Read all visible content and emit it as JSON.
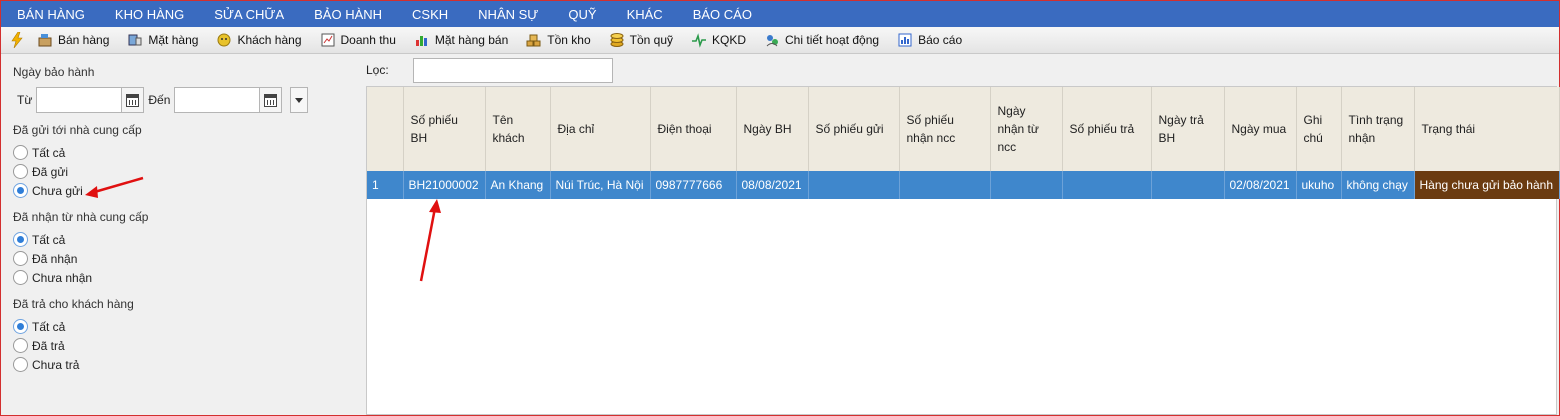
{
  "menu": [
    "BÁN HÀNG",
    "KHO HÀNG",
    "SỬA CHỮA",
    "BẢO HÀNH",
    "CSKH",
    "NHÂN SỰ",
    "QUỸ",
    "KHÁC",
    "BÁO CÁO"
  ],
  "toolbar": [
    {
      "label": "Bán hàng",
      "icon": "cashier-icon"
    },
    {
      "label": "Mặt hàng",
      "icon": "product-icon"
    },
    {
      "label": "Khách hàng",
      "icon": "customer-icon"
    },
    {
      "label": "Doanh thu",
      "icon": "revenue-icon"
    },
    {
      "label": "Mặt hàng bán",
      "icon": "chart-icon"
    },
    {
      "label": "Tồn kho",
      "icon": "stock-icon"
    },
    {
      "label": "Tồn quỹ",
      "icon": "coins-icon"
    },
    {
      "label": "KQKD",
      "icon": "pulse-icon"
    },
    {
      "label": "Chi tiết hoạt động",
      "icon": "activity-icon"
    },
    {
      "label": "Báo cáo",
      "icon": "report-icon"
    }
  ],
  "filters": {
    "date_title": "Ngày bảo hành",
    "from_label": "Từ",
    "to_label": "Đến",
    "from_value": "",
    "to_value": "",
    "sent_title": "Đã gửi tới nhà cung cấp",
    "sent_options": [
      "Tất cả",
      "Đã gửi",
      "Chưa gửi"
    ],
    "sent_selected": 2,
    "received_title": "Đã nhận từ nhà cung cấp",
    "received_options": [
      "Tất cả",
      "Đã nhận",
      "Chưa nhận"
    ],
    "received_selected": 0,
    "returned_title": "Đã trả cho khách hàng",
    "returned_options": [
      "Tất cả",
      "Đã trả",
      "Chưa trả"
    ],
    "returned_selected": 0
  },
  "search": {
    "label": "Lọc:",
    "value": ""
  },
  "table": {
    "headers": [
      "",
      "Số phiếu BH",
      "Tên khách",
      "Địa chỉ",
      "Điện thoại",
      "Ngày BH",
      "Số phiếu gửi",
      "Số phiếu nhận ncc",
      "Ngày nhận từ ncc",
      "Số phiếu trả",
      "Ngày trả BH",
      "Ngày mua",
      "Ghi chú",
      "Tình trạng nhận",
      "Trạng thái"
    ],
    "rows": [
      [
        "1",
        "BH21000002",
        "An Khang",
        "Núi Trúc, Hà Nội",
        "0987777666",
        "08/08/2021",
        "",
        "",
        "",
        "",
        "",
        "02/08/2021",
        "ukuho",
        "không chạy",
        "Hàng chưa gửi bảo hành"
      ]
    ]
  },
  "colors": {
    "menu_bg": "#3a6bc0",
    "selected_row": "#3f87cc",
    "status_cell": "#6b3b10",
    "annotation_arrow": "#e01010"
  }
}
